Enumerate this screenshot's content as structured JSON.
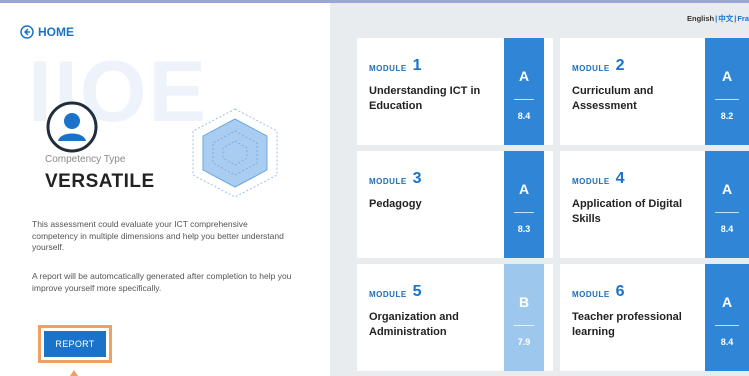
{
  "header": {
    "home_label": "HOME",
    "watermark": "IIOE",
    "language_links": [
      "English",
      "中文",
      "Fra"
    ]
  },
  "profile": {
    "type_label": "Competency Type",
    "type_value": "VERSATILE",
    "description_1": "This assessment could evaluate your ICT comprehensive competency in multiple dimensions and help you better understand yourself.",
    "description_2": "A report will be automcatically generated after completion to help you improve yourself more specifically.",
    "report_button": "REPORT"
  },
  "colors": {
    "primary": "#1a73c8",
    "grade_a": "#2f86d6",
    "grade_b": "#9ec7ee",
    "highlight": "#f0a060",
    "panel_bg": "#e9ecef"
  },
  "modules": [
    {
      "word": "MODULE",
      "number": "1",
      "title": "Understanding ICT in Education",
      "grade": "A",
      "score": "8.4"
    },
    {
      "word": "MODULE",
      "number": "2",
      "title": "Curriculum and Assessment",
      "grade": "A",
      "score": "8.2"
    },
    {
      "word": "MODULE",
      "number": "3",
      "title": "Pedagogy",
      "grade": "A",
      "score": "8.3"
    },
    {
      "word": "MODULE",
      "number": "4",
      "title": "Application of Digital Skills",
      "grade": "A",
      "score": "8.4"
    },
    {
      "word": "MODULE",
      "number": "5",
      "title": "Organization and Administration",
      "grade": "B",
      "score": "7.9"
    },
    {
      "word": "MODULE",
      "number": "6",
      "title": "Teacher professional learning",
      "grade": "A",
      "score": "8.4"
    }
  ]
}
